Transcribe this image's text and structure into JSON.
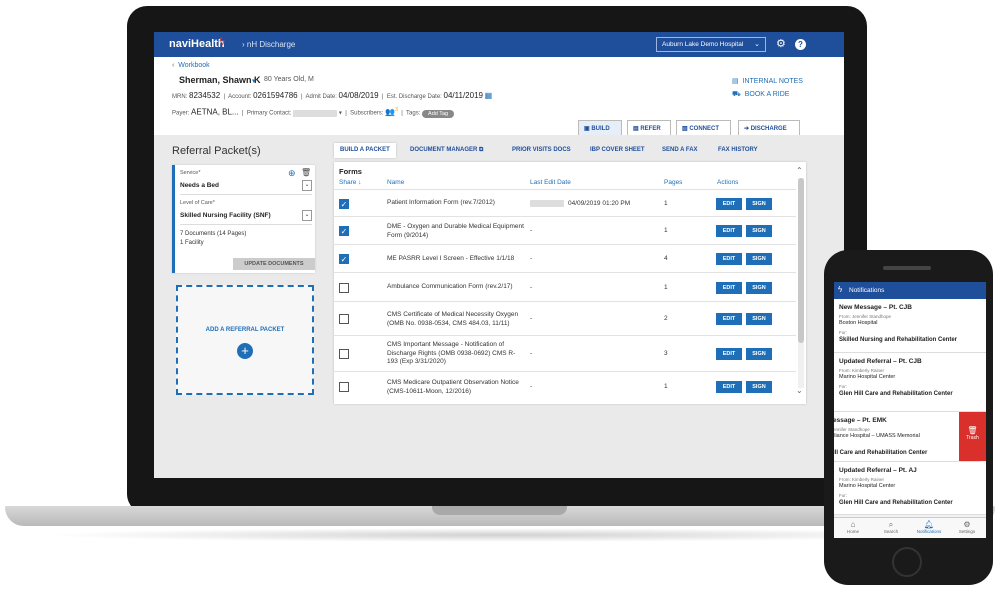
{
  "header": {
    "logo": "naviHealth",
    "app_crumb": "› nH Discharge",
    "hospital": "Auburn Lake Demo Hospital",
    "settings_icon": "gear-icon",
    "help_icon": "question-circle-icon"
  },
  "patient": {
    "back_link": "Workbook",
    "name": "Sherman, Shawn K",
    "age_sex": "80 Years Old, M",
    "mrn_label": "MRN:",
    "mrn": "8234532",
    "account_label": "Account:",
    "account": "0261594786",
    "admit_label": "Admit Date:",
    "admit_date": "04/08/2019",
    "est_label": "Est. Discharge Date:",
    "est_date": "04/11/2019",
    "payer_label": "Payer:",
    "payer": "AETNA, BL...",
    "contact_label": "Primary Contact:",
    "subscribers_label": "Subscribers:",
    "subscribers_count": "3",
    "tags_label": "Tags:",
    "add_tag": "Add Tag",
    "internal_notes": "INTERNAL NOTES",
    "book_ride": "BOOK A RIDE"
  },
  "main_tabs": [
    {
      "label": "BUILD",
      "icon": "build-icon"
    },
    {
      "label": "REFER",
      "icon": "refer-icon"
    },
    {
      "label": "CONNECT",
      "icon": "connect-icon"
    },
    {
      "label": "DISCHARGE",
      "icon": "discharge-icon"
    }
  ],
  "referral": {
    "title": "Referral Packet(s)",
    "service_label": "Service*",
    "service_value": "Needs a Bed",
    "loc_label": "Level of Care*",
    "loc_value": "Skilled Nursing Facility (SNF)",
    "docs": "7 Documents (14 Pages)",
    "facility": "1 Facility",
    "update_btn": "UPDATE DOCUMENTS",
    "add_packet": "ADD A REFERRAL PACKET"
  },
  "sub_tabs": [
    "BUILD A PACKET",
    "DOCUMENT MANAGER",
    "PRIOR VISITS DOCS",
    "IBP COVER SHEET",
    "SEND A FAX",
    "FAX HISTORY"
  ],
  "forms": {
    "title": "Forms",
    "headers": {
      "share": "Share ↓",
      "name": "Name",
      "last_edit": "Last Edit Date",
      "pages": "Pages",
      "actions": "Actions"
    },
    "edit_label": "EDIT",
    "sign_label": "SIGN",
    "rows": [
      {
        "name": "Patient Information Form (rev.7/2012)",
        "date": "04/09/2019 01:20 PM",
        "pages": "1",
        "checked": true
      },
      {
        "name": "DME - Oxygen and Durable Medical Equipment Form (9/2014)",
        "date": "-",
        "pages": "1",
        "checked": true
      },
      {
        "name": "ME PASRR Level I Screen - Effective 1/1/18",
        "date": "-",
        "pages": "4",
        "checked": true
      },
      {
        "name": "Ambulance Communication Form (rev.2/17)",
        "date": "-",
        "pages": "1",
        "checked": false
      },
      {
        "name": "CMS Certificate of Medical Necessity Oxygen (OMB No. 0938-0534, CMS 484.03, 11/11)",
        "date": "-",
        "pages": "2",
        "checked": false
      },
      {
        "name": "CMS Important Message - Notification of Discharge Rights (OMB 0938-0692) CMS R-193 (Exp 3/31/2020)",
        "date": "-",
        "pages": "3",
        "checked": false
      },
      {
        "name": "CMS Medicare Outpatient Observation Notice (CMS-10611-Moon, 12/2016)",
        "date": "-",
        "pages": "1",
        "checked": false
      }
    ]
  },
  "phone": {
    "title": "Notifications",
    "notifications": [
      {
        "title": "New Message – Pt. CJB",
        "from_label": "From:",
        "from": "Jennifer Standhope",
        "org": "Boston Hospital",
        "for_label": "For:",
        "for": "Skilled Nursing and Rehabilitation Center"
      },
      {
        "title": "Updated Referral – Pt. CJB",
        "from_label": "From:",
        "from": "Kimberly Rainer",
        "org": "Marino Hospital Center",
        "for_label": "For:",
        "for": "Glen Hill Care and Rehabilitation Center"
      },
      {
        "title": "essage – Pt. EMK",
        "from_label": "",
        "from": "ennifer Standhope",
        "org": "lliance Hospital – UMASS Memorial",
        "for_label": "",
        "for": "ill Care and Rehabilitation Center"
      },
      {
        "title": "Updated Referral – Pt. AJ",
        "from_label": "From:",
        "from": "Kimberly Rainer",
        "org": "Marino Hospital Center",
        "for_label": "For:",
        "for": "Glen Hill Care and Rehabilitation Center"
      }
    ],
    "trash_label": "Trash",
    "tabs": [
      "Home",
      "Search",
      "Notifications",
      "Settings"
    ]
  }
}
